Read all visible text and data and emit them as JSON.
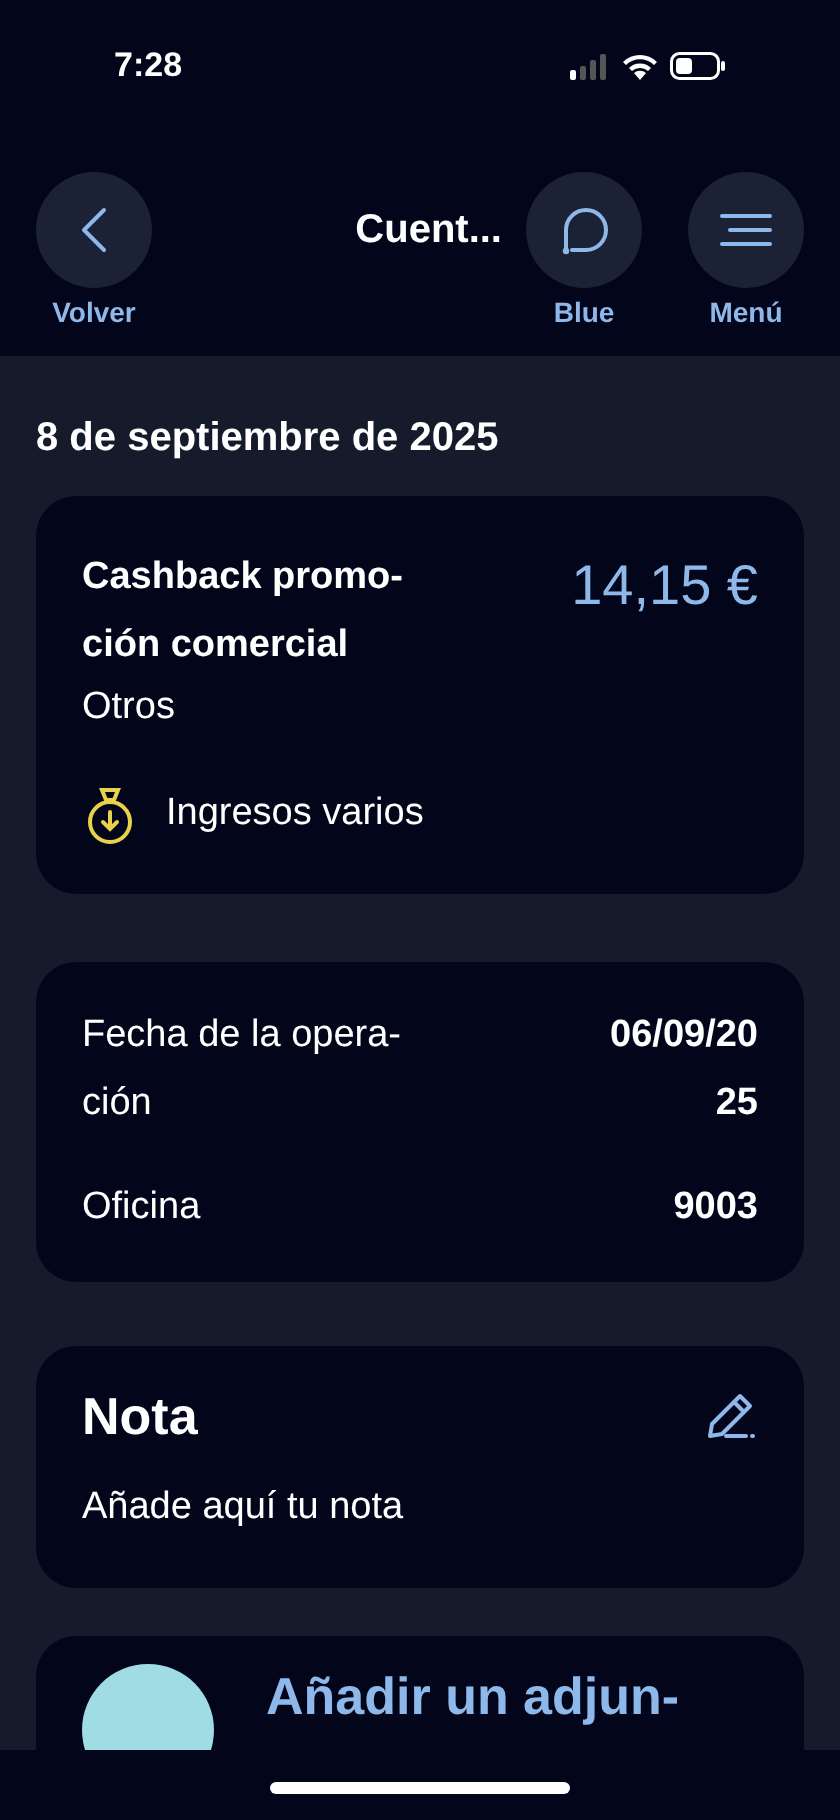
{
  "status_bar": {
    "time": "7:28"
  },
  "header": {
    "title": "Cuent...",
    "back": {
      "label": "Volver"
    },
    "actions": [
      {
        "kind": "chat",
        "label": "Blue"
      },
      {
        "kind": "menu",
        "label": "Menú"
      }
    ]
  },
  "date": "8 de septiembre de 2025",
  "transaction": {
    "title": "Cashback promo-\nción comercial",
    "amount": "14,15 €",
    "subtitle": "Otros",
    "category": "Ingresos varios"
  },
  "details": [
    {
      "label": "Fecha de la opera-\nción",
      "value": "06/09/20\n25"
    },
    {
      "label": "Oficina",
      "value": "9003"
    }
  ],
  "note": {
    "title": "Nota",
    "placeholder": "Añade aquí tu nota"
  },
  "attachment": {
    "title": "Añadir un adjun-"
  }
}
